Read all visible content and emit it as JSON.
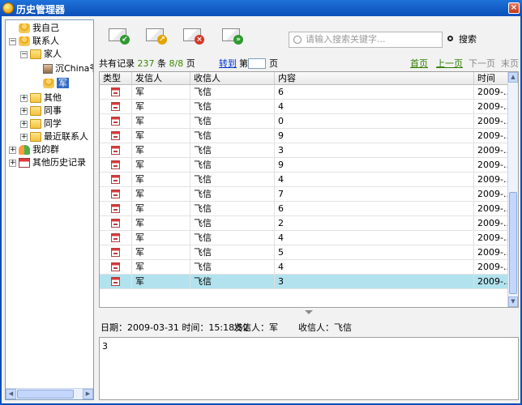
{
  "window": {
    "title": "历史管理器",
    "close_glyph": "×"
  },
  "tree": {
    "items": [
      {
        "label": "我自己",
        "icon": "person-icon",
        "expander": ""
      },
      {
        "label": "联系人",
        "icon": "person-icon",
        "expander": "−"
      },
      {
        "label": "家人",
        "icon": "folder-icon",
        "expander": "−"
      },
      {
        "label": "沉China爷",
        "icon": "avatar-icon",
        "expander": ""
      },
      {
        "label": "军",
        "icon": "person-icon",
        "expander": ""
      },
      {
        "label": "其他",
        "icon": "folder-icon",
        "expander": "+"
      },
      {
        "label": "同事",
        "icon": "folder-icon",
        "expander": "+"
      },
      {
        "label": "同学",
        "icon": "folder-icon",
        "expander": "+"
      },
      {
        "label": "最近联系人",
        "icon": "folder-icon",
        "expander": "+"
      },
      {
        "label": "我的群",
        "icon": "group-icon",
        "expander": "+"
      },
      {
        "label": "其他历史记录",
        "icon": "calendar-icon",
        "expander": "+"
      }
    ]
  },
  "toolbar": {
    "search_placeholder": "请输入搜索关键字...",
    "search_label": "搜索"
  },
  "pager": {
    "total_prefix": "共有记录",
    "total_count": "237",
    "total_unit": "条",
    "page_status": "8/8",
    "page_unit_1": "页",
    "goto_label": "转到",
    "page_prefix": "第",
    "page_unit_2": "页",
    "first": "首页",
    "prev": "上一页",
    "next": "下一页",
    "last": "末页"
  },
  "table": {
    "columns": [
      "类型",
      "发信人",
      "收信人",
      "内容",
      "时间"
    ],
    "rows": [
      {
        "sender": "军",
        "recipient": "飞信",
        "content": "6",
        "time": "2009-..."
      },
      {
        "sender": "军",
        "recipient": "飞信",
        "content": "4",
        "time": "2009-..."
      },
      {
        "sender": "军",
        "recipient": "飞信",
        "content": "0",
        "time": "2009-..."
      },
      {
        "sender": "军",
        "recipient": "飞信",
        "content": "9",
        "time": "2009-..."
      },
      {
        "sender": "军",
        "recipient": "飞信",
        "content": "3",
        "time": "2009-..."
      },
      {
        "sender": "军",
        "recipient": "飞信",
        "content": "9",
        "time": "2009-..."
      },
      {
        "sender": "军",
        "recipient": "飞信",
        "content": "4",
        "time": "2009-..."
      },
      {
        "sender": "军",
        "recipient": "飞信",
        "content": "7",
        "time": "2009-..."
      },
      {
        "sender": "军",
        "recipient": "飞信",
        "content": "6",
        "time": "2009-..."
      },
      {
        "sender": "军",
        "recipient": "飞信",
        "content": "2",
        "time": "2009-..."
      },
      {
        "sender": "军",
        "recipient": "飞信",
        "content": "4",
        "time": "2009-..."
      },
      {
        "sender": "军",
        "recipient": "飞信",
        "content": "5",
        "time": "2009-..."
      },
      {
        "sender": "军",
        "recipient": "飞信",
        "content": "4",
        "time": "2009-..."
      },
      {
        "sender": "军",
        "recipient": "飞信",
        "content": "3",
        "time": "2009-..."
      }
    ]
  },
  "detail": {
    "date_text": "日期：2009-03-31  时间：15:18:52",
    "sender_text": "发信人：军",
    "recipient_text": "收信人：飞信",
    "message": "3"
  },
  "colors": {
    "title_bar": "#0b4fb8",
    "selected_row": "#b2e2ee",
    "pager_green": "#3a8a00",
    "goto_link": "#0033cc"
  }
}
